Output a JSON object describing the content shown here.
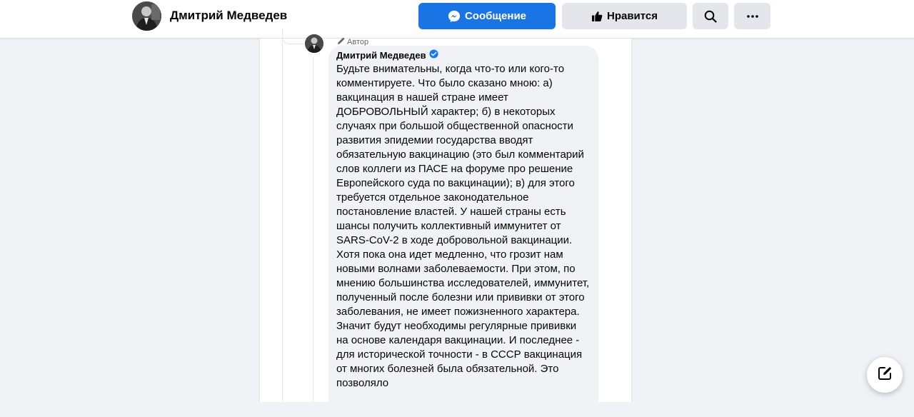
{
  "header": {
    "profile_name": "Дмитрий Медведев",
    "buttons": {
      "message_label": "Сообщение",
      "like_label": "Нравится"
    },
    "icons": {
      "message": "messenger-icon",
      "like": "thumbs-up-icon",
      "search": "search-icon",
      "more": "more-dots-icon"
    }
  },
  "comment": {
    "badge_label": "Автор",
    "badge_icon": "pencil-icon",
    "author": "Дмитрий Медведев",
    "verified_icon": "verified-badge-icon",
    "text": "Будьте внимательны, когда что-то или кого-то комментируете. Что было сказано мною: а) вакцинация в нашей стране имеет ДОБРОВОЛЬНЫЙ характер; б) в некоторых случаях при большой общественной опасности развития эпидемии государства вводят обязательную вакцинацию (это был комментарий слов коллеги из ПАСЕ на форуме про решение Европейского суда по вакцинации); в) для этого требуется отдельное законодательное постановление властей. У нашей страны есть шансы получить коллективный иммунитет от SARS-CoV-2 в ходе добровольной вакцинации. Хотя пока она идет медленно, что грозит нам новыми волнами заболеваемости. При этом, по мнению большинства исследователей, иммунитет, полученный после болезни или прививки от этого заболевания, не имеет пожизненного характера. Значит будут необходимы регулярные прививки на основе календаря вакцинации. И последнее - для исторической точности - в СССР вакцинация от многих болезней была обязательной. Это позволяло"
  },
  "fab": {
    "icon": "compose-icon"
  },
  "colors": {
    "accent": "#1b74e4",
    "button_gray": "#e4e6eb",
    "page_bg": "#f0f2f5",
    "verified": "#1877f2"
  }
}
